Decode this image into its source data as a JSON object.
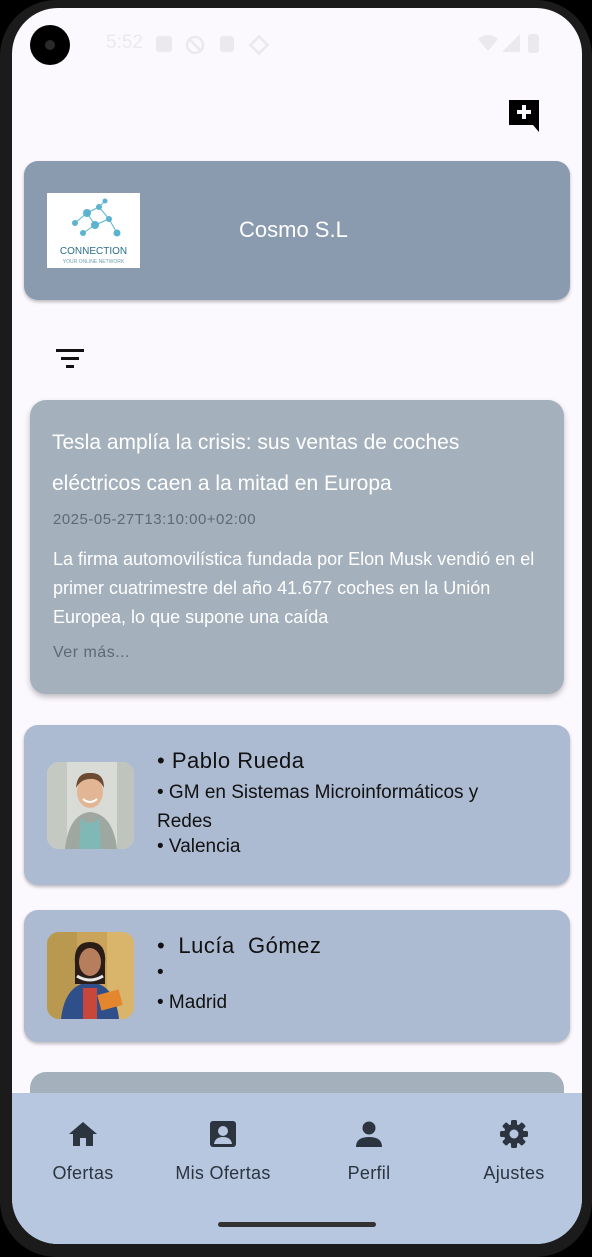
{
  "status_bar": {
    "time": "5:52"
  },
  "header": {
    "compose_icon": "add-comment-icon"
  },
  "company": {
    "name": "Cosmo S.L",
    "logo_text": "CONNECTION",
    "logo_subtext": "YOUR ONLINE NETWORK"
  },
  "filter": {
    "icon": "filter-list-icon"
  },
  "news": {
    "title": "Tesla amplía la crisis: sus ventas de coches eléctricos caen a la mitad en Europa",
    "date": "2025-05-27T13:10:00+02:00",
    "body": "La firma automovilística fundada por Elon Musk vendió en el primer cuatrimestre del año 41.677 coches en la Unión Europea, lo que supone una caída",
    "more": "Ver más..."
  },
  "people": [
    {
      "name": "• Pablo Rueda",
      "line2": "• GM en Sistemas Microinformáticos y Redes",
      "line3": "• Valencia"
    },
    {
      "name": "•  Lucía  Gómez",
      "line2": "•",
      "line3": "• Madrid"
    }
  ],
  "nav": [
    {
      "label": "Ofertas",
      "icon": "home-icon"
    },
    {
      "label": "Mis Ofertas",
      "icon": "account-box-icon"
    },
    {
      "label": "Perfil",
      "icon": "person-icon"
    },
    {
      "label": "Ajustes",
      "icon": "settings-icon"
    }
  ]
}
